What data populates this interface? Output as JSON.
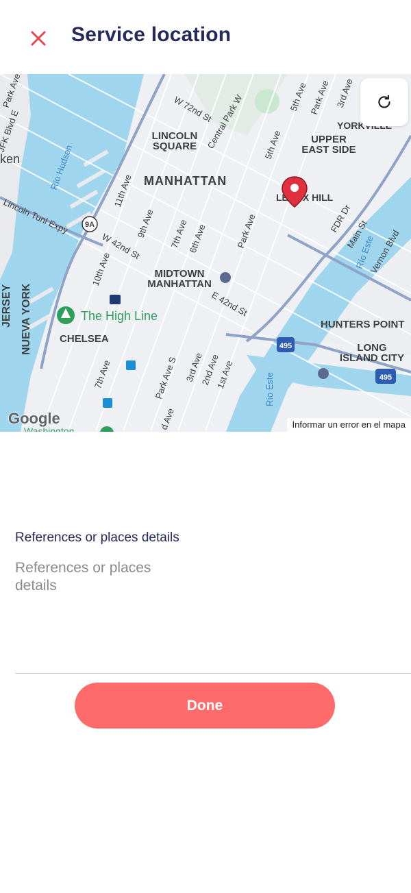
{
  "header": {
    "title": "Service location",
    "close_icon": "close-icon",
    "accent": "#e5484d"
  },
  "map": {
    "labels": {
      "lincoln_square": [
        "LINCOLN",
        "SQUARE"
      ],
      "manhattan": "MANHATTAN",
      "upper_east_side": [
        "UPPER",
        "EAST SIDE"
      ],
      "yorkville": "YORKVILLE",
      "lenox_hill": "LENOX HILL",
      "midtown_manhattan": [
        "MIDTOWN",
        "MANHATTAN"
      ],
      "chelsea": "CHELSEA",
      "high_line": "The High Line",
      "hunters_point": "HUNTERS POINT",
      "long_island_city": [
        "LONG",
        "ISLAND CITY"
      ],
      "nueva_york": "NUEVA YORK",
      "jersey": "JERSEY",
      "hoboken_partial": "ken",
      "rio_hudson": "Río Hudson",
      "rio_este_1": "Río Este",
      "rio_este_2": "Río Este",
      "lincoln_tunl": "Lincoln Tunl Expy",
      "w72": "W 72nd St",
      "w42": "W 42nd St",
      "e42": "E 42nd St",
      "central_park_w": "Central Park W",
      "fifth_ave_1": "5th Ave",
      "fifth_ave_2": "5th Ave",
      "park_ave_1": "Park Ave",
      "park_ave_2": "Park Ave",
      "park_ave_nj": "Park Ave",
      "third_ave_1": "3rd Ave",
      "third_ave_2": "3rd Ave",
      "second_ave": "2nd Ave",
      "first_ave": "1st Ave",
      "eleventh_ave": "11th Ave",
      "tenth_ave": "10th Ave",
      "ninth_ave": "9th Ave",
      "seventh_ave_1": "7th Ave",
      "seventh_ave_2": "7th Ave",
      "sixth_ave": "6th Ave",
      "park_ave_s": "Park Ave S",
      "fdr": "FDR Dr",
      "main_st": "Main St",
      "vernon": "Vernon Blvd",
      "jfk": "JFK Blvd E",
      "route_9a": "9A",
      "i495_1": "495",
      "i495_2": "495",
      "washington_partial": "Washington",
      "ave_partial": "d Ave"
    },
    "google_logo": "Google",
    "report_error": "Informar un error en el mapa",
    "refresh_icon": "refresh-icon",
    "pin_icon": "location-pin-icon",
    "colors": {
      "water": "#9fd6ee",
      "land": "#eef0f3",
      "highway": "#8fa3c7",
      "park": "#c9e8cf",
      "pin": "#e0303d"
    }
  },
  "form": {
    "label": "References or places details",
    "placeholder": "References or places details",
    "value": ""
  },
  "actions": {
    "done_label": "Done",
    "done_color": "#ff6b6b"
  }
}
